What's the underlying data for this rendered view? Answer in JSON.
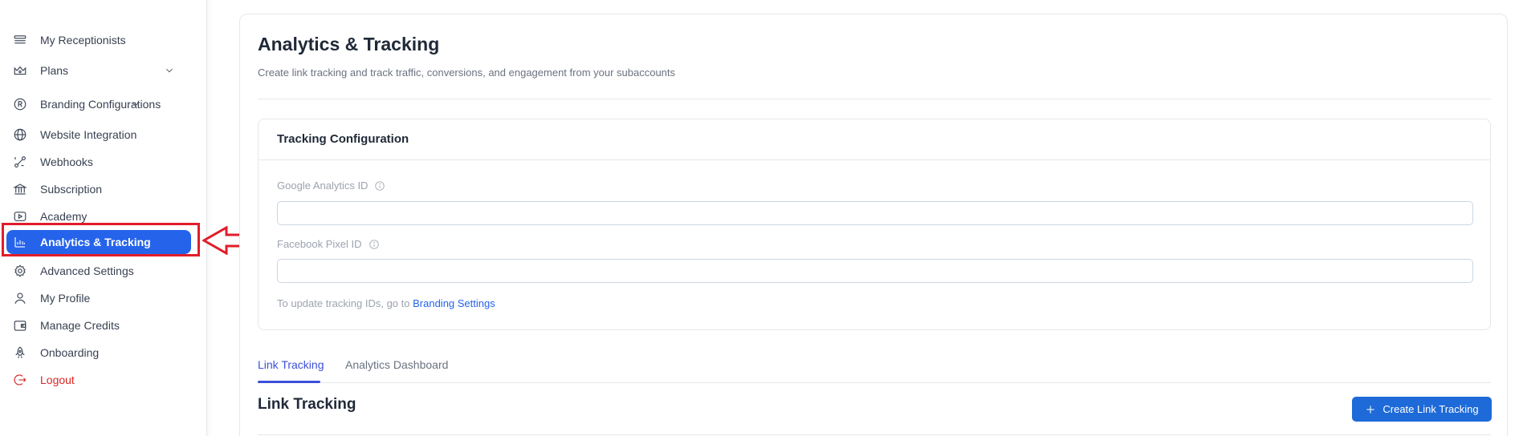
{
  "sidebar": {
    "items": [
      {
        "label": "My Receptionists",
        "icon": "receptionist-icon"
      },
      {
        "label": "Plans",
        "icon": "crown-icon",
        "has_chevron": true
      },
      {
        "label": "Branding Configurations",
        "icon": "registered-icon",
        "has_chevron": true
      },
      {
        "label": "Website Integration",
        "icon": "globe-icon"
      },
      {
        "label": "Webhooks",
        "icon": "webhook-icon"
      },
      {
        "label": "Subscription",
        "icon": "bank-icon"
      },
      {
        "label": "Academy",
        "icon": "video-icon"
      },
      {
        "label": "Analytics & Tracking",
        "icon": "bar-chart-icon",
        "active": true
      },
      {
        "label": "Advanced Settings",
        "icon": "gear-icon"
      },
      {
        "label": "My Profile",
        "icon": "user-icon"
      },
      {
        "label": "Manage Credits",
        "icon": "wallet-icon"
      },
      {
        "label": "Onboarding",
        "icon": "rocket-icon"
      },
      {
        "label": "Logout",
        "icon": "logout-icon"
      }
    ]
  },
  "page": {
    "title": "Analytics & Tracking",
    "subtitle": "Create link tracking and track traffic, conversions, and engagement from your subaccounts"
  },
  "config": {
    "title": "Tracking Configuration",
    "ga_label": "Google Analytics ID",
    "ga_value": "",
    "fb_label": "Facebook Pixel ID",
    "fb_value": "",
    "hint_text": "To update tracking IDs, go to ",
    "hint_link": "Branding Settings"
  },
  "tabs": [
    {
      "label": "Link Tracking",
      "active": true
    },
    {
      "label": "Analytics Dashboard",
      "active": false
    }
  ],
  "link_tracking": {
    "title": "Link Tracking",
    "create_button": "Create Link Tracking"
  },
  "colors": {
    "accent": "#2563eb",
    "highlight_annotation": "#e11d2a",
    "logout": "#dc2626"
  }
}
